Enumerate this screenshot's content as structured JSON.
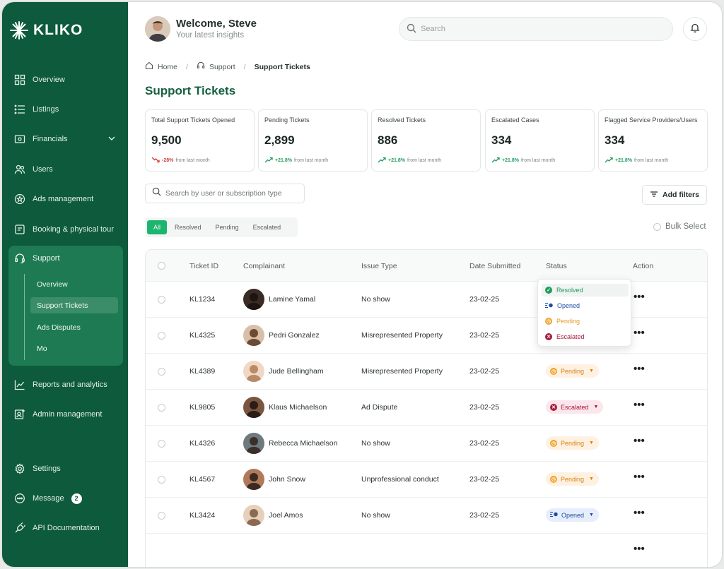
{
  "brand": {
    "name": "KLIKO",
    "accent": "#0d5a3c",
    "highlight": "#1db56d"
  },
  "sidebar": {
    "items": [
      {
        "label": "Overview",
        "icon": "grid-icon"
      },
      {
        "label": "Listings",
        "icon": "list-icon"
      },
      {
        "label": "Financials",
        "icon": "wallet-icon"
      },
      {
        "label": "Users",
        "icon": "users-icon"
      },
      {
        "label": "Ads management",
        "icon": "star-badge-icon"
      },
      {
        "label": "Booking & physical tour",
        "icon": "calendar-icon"
      }
    ],
    "support": {
      "label": "Support",
      "icon": "headset-icon",
      "subitems": [
        "Overview",
        "Support Tickets",
        "Ads Disputes",
        "Mo"
      ]
    },
    "bottom_items": [
      {
        "label": "Reports and analytics",
        "icon": "chart-icon"
      },
      {
        "label": "Admin management",
        "icon": "admin-icon"
      }
    ],
    "footer_items": [
      {
        "label": "Settings",
        "icon": "gear-icon"
      },
      {
        "label": "Message",
        "icon": "chat-icon",
        "badge": "2"
      },
      {
        "label": "API Documentation",
        "icon": "plug-icon"
      }
    ]
  },
  "header": {
    "welcome": "Welcome, Steve",
    "subtitle": "Your latest insights",
    "search_placeholder": "Search"
  },
  "breadcrumb": {
    "home": "Home",
    "support": "Support",
    "current": "Support Tickets"
  },
  "page_title": "Support Tickets",
  "stats": [
    {
      "label": "Total Support Tickets Opened",
      "value": "9,500",
      "change": "-28%",
      "direction": "down",
      "note": "from last month"
    },
    {
      "label": "Pending Tickets",
      "value": "2,899",
      "change": "+21.8%",
      "direction": "up",
      "note": "from last month"
    },
    {
      "label": "Resolved Tickets",
      "value": "886",
      "change": "+21.8%",
      "direction": "up",
      "note": "from last month"
    },
    {
      "label": "Escalated Cases",
      "value": "334",
      "change": "+21.8%",
      "direction": "up",
      "note": "from last month"
    },
    {
      "label": "Flagged Service Providers/Users",
      "value": "334",
      "change": "+21.8%",
      "direction": "up",
      "note": "from last month"
    }
  ],
  "filters": {
    "search_placeholder": "Search by user or subscription type",
    "add_filters": "Add filters",
    "tabs": [
      "All",
      "Resolved",
      "Pending",
      "Escalated"
    ],
    "active_tab": "All",
    "bulk_select": "Bulk Select"
  },
  "table": {
    "columns": [
      "Ticket ID",
      "Complainant",
      "Issue Type",
      "Date Submitted",
      "Status",
      "Action"
    ],
    "rows": [
      {
        "id": "KL1234",
        "name": "Lamine Yamal",
        "issue": "No show",
        "date": "23-02-25",
        "status": ""
      },
      {
        "id": "KL4325",
        "name": "Pedri Gonzalez",
        "issue": "Misrepresented Property",
        "date": "23-02-25",
        "status": ""
      },
      {
        "id": "KL4389",
        "name": "Jude Bellingham",
        "issue": "Misrepresented Property",
        "date": "23-02-25",
        "status": "Pending"
      },
      {
        "id": "KL9805",
        "name": "Klaus Michaelson",
        "issue": "Ad Dispute",
        "date": "23-02-25",
        "status": "Escalated"
      },
      {
        "id": "KL4326",
        "name": "Rebecca Michaelson",
        "issue": "No show",
        "date": "23-02-25",
        "status": "Pending"
      },
      {
        "id": "KL4567",
        "name": "John Snow",
        "issue": "Unprofessional conduct",
        "date": "23-02-25",
        "status": "Pending"
      },
      {
        "id": "KL3424",
        "name": "Joel Amos",
        "issue": "No show",
        "date": "23-02-25",
        "status": "Opened"
      }
    ]
  },
  "status_dropdown": {
    "options": [
      {
        "label": "Resolved",
        "color": "#1f9d5c",
        "icon": "check-circle-icon"
      },
      {
        "label": "Opened",
        "color": "#1f4ca8",
        "icon": "opened-icon"
      },
      {
        "label": "Pending",
        "color": "#e59a1e",
        "icon": "clock-icon"
      },
      {
        "label": "Escalated",
        "color": "#a51d40",
        "icon": "x-circle-icon"
      }
    ]
  }
}
